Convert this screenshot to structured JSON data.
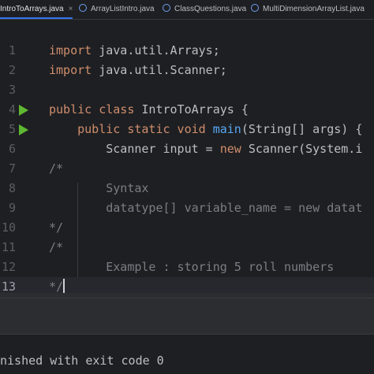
{
  "tabs": [
    {
      "label": "IntroToArrays.java",
      "close": "×",
      "active": true
    },
    {
      "label": "ArrayListIntro.java",
      "active": false
    },
    {
      "label": "ClassQuestions.java",
      "active": false
    },
    {
      "label": "MultiDimensionArrayList.java",
      "active": false
    }
  ],
  "editor": {
    "lines": [
      {
        "num": "1",
        "parts": [
          {
            "t": "import",
            "c": "kw"
          },
          {
            "t": " java.util.Arrays;"
          }
        ]
      },
      {
        "num": "2",
        "parts": [
          {
            "t": "import",
            "c": "kw"
          },
          {
            "t": " java.util.Scanner;"
          }
        ]
      },
      {
        "num": "3",
        "parts": []
      },
      {
        "num": "4",
        "run": true,
        "parts": [
          {
            "t": "public class",
            "c": "kw"
          },
          {
            "t": " IntroToArrays {"
          }
        ]
      },
      {
        "num": "5",
        "run": true,
        "parts": [
          {
            "t": "    "
          },
          {
            "t": "public static void",
            "c": "kw"
          },
          {
            "t": " "
          },
          {
            "t": "main",
            "c": "fn"
          },
          {
            "t": "(String[] args) {"
          }
        ]
      },
      {
        "num": "6",
        "parts": [
          {
            "t": "        Scanner input = "
          },
          {
            "t": "new",
            "c": "kw"
          },
          {
            "t": " Scanner(System.i"
          }
        ]
      },
      {
        "num": "7",
        "parts": [
          {
            "t": "/*",
            "c": "cm"
          }
        ]
      },
      {
        "num": "8",
        "parts": [
          {
            "t": "        Syntax",
            "c": "cm"
          }
        ]
      },
      {
        "num": "9",
        "parts": [
          {
            "t": "        datatype[] variable_name = new datat",
            "c": "cm"
          }
        ]
      },
      {
        "num": "10",
        "parts": [
          {
            "t": "*/",
            "c": "cm"
          }
        ]
      },
      {
        "num": "11",
        "parts": [
          {
            "t": "/*",
            "c": "cm"
          }
        ]
      },
      {
        "num": "12",
        "parts": [
          {
            "t": "        Example : storing 5 roll numbers",
            "c": "cm"
          }
        ]
      },
      {
        "num": "13",
        "current": true,
        "caret": true,
        "parts": [
          {
            "t": "*/",
            "c": "cm"
          }
        ]
      }
    ]
  },
  "console": {
    "text": "nished with exit code 0"
  }
}
